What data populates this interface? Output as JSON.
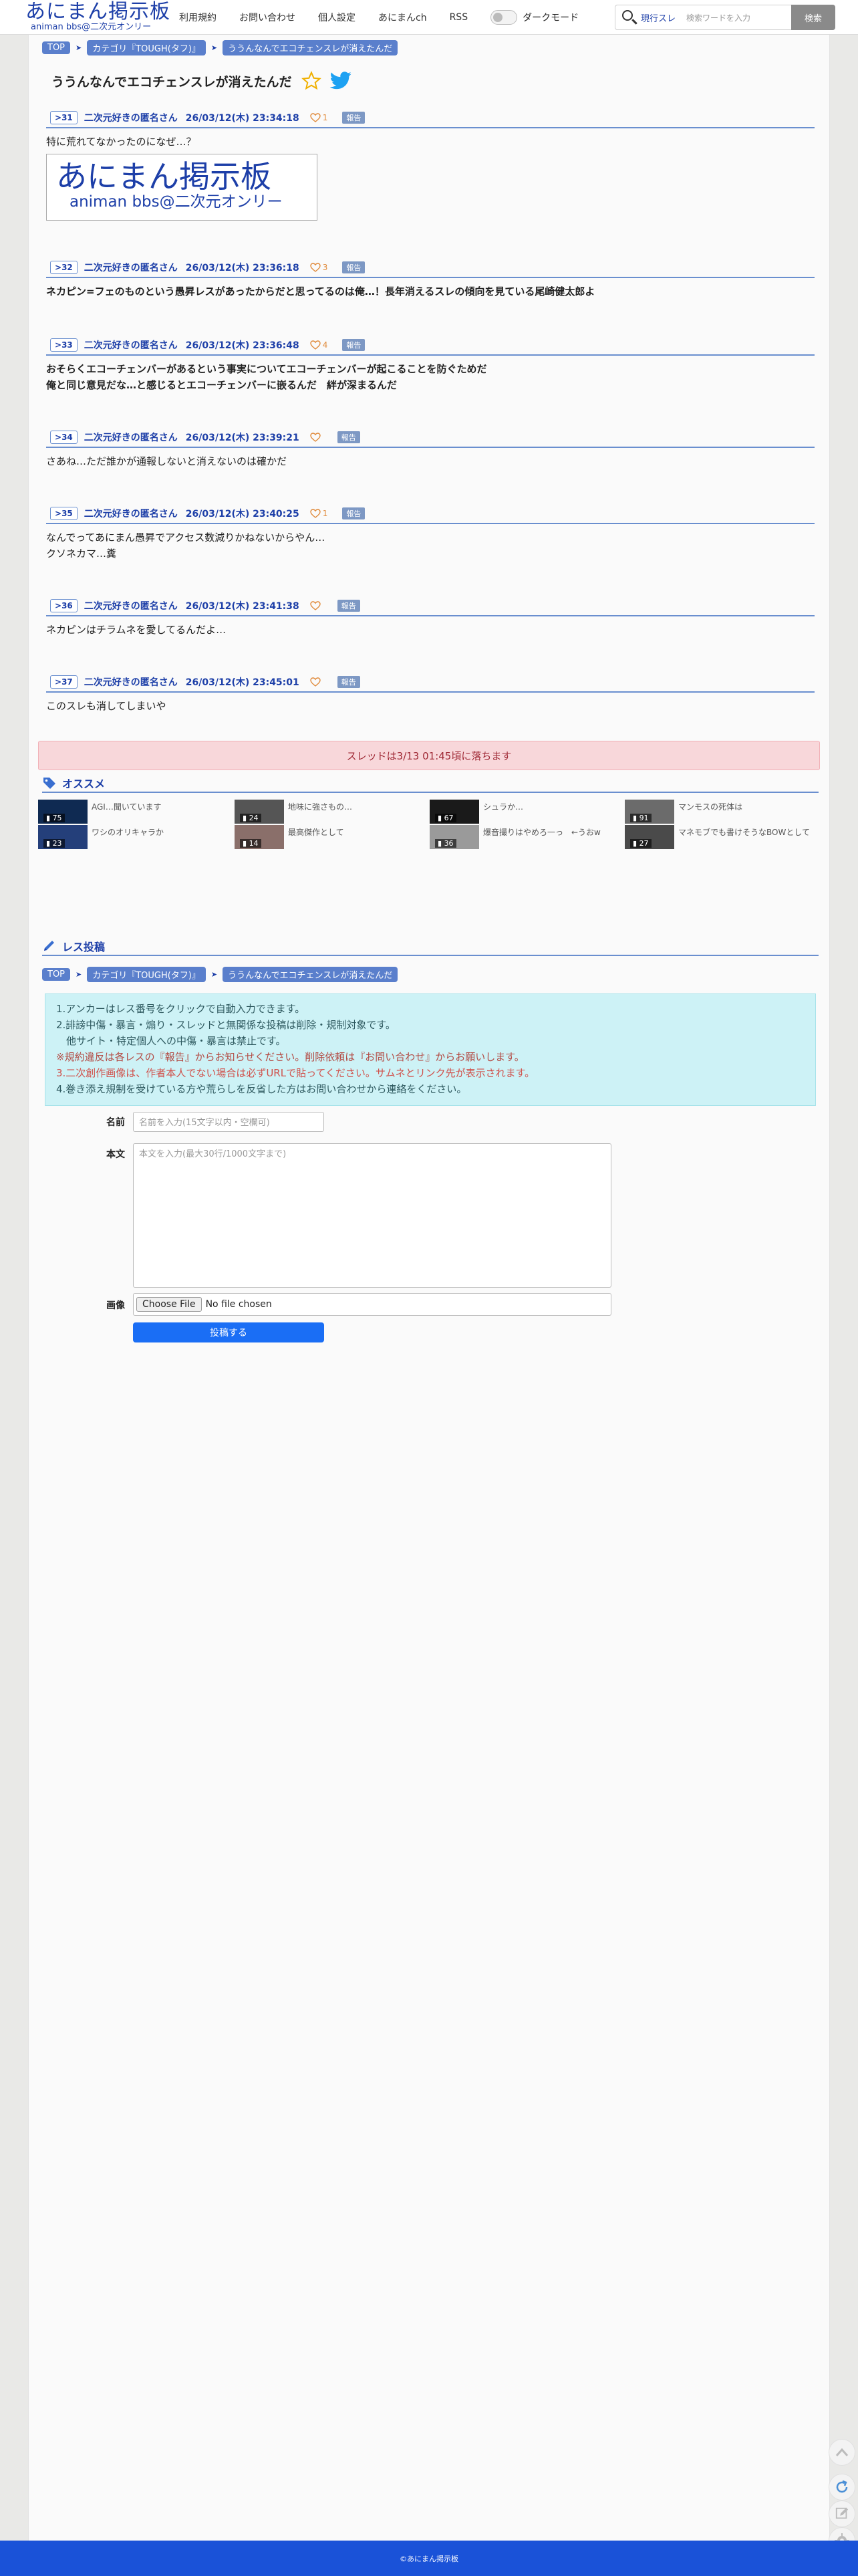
{
  "header": {
    "logo_main": "あにまん掲示板",
    "logo_sub": "animan bbs@二次元オンリー",
    "nav": [
      "利用規約",
      "お問い合わせ",
      "個人設定",
      "あにまんch",
      "RSS"
    ],
    "dark_mode_label": "ダークモード",
    "search_scope": "現行スレ",
    "search_placeholder": "検索ワードを入力",
    "search_button": "検索"
  },
  "breadcrumb": {
    "top": "TOP",
    "category": "カテゴリ『TOUGH(タフ)』",
    "thread": "ううんなんでエコチェンスレが消えたんだ"
  },
  "thread_title": "ううんなんでエコチェンスレが消えたんだ",
  "posts": [
    {
      "num": "31",
      "name": "二次元好きの匿名さん",
      "date": "26/03/12(木) 23:34:18",
      "likes": "1",
      "report": "報告",
      "body": [
        "特に荒れてなかったのになぜ…？"
      ],
      "bold": false,
      "image": {
        "main": "あにまん掲示板",
        "sub": "animan bbs@二次元オンリー"
      }
    },
    {
      "num": "32",
      "name": "二次元好きの匿名さん",
      "date": "26/03/12(木) 23:36:18",
      "likes": "3",
      "report": "報告",
      "body": [
        "ネカピン=フェのものという愚昇レスがあったからだと思ってるのは俺…！長年消えるスレの傾向を見ている尾崎健太郎よ"
      ],
      "bold": true
    },
    {
      "num": "33",
      "name": "二次元好きの匿名さん",
      "date": "26/03/12(木) 23:36:48",
      "likes": "4",
      "report": "報告",
      "body": [
        "おそらくエコーチェンバーがあるという事実についてエコーチェンバーが起こることを防ぐためだ",
        "俺と同じ意見だな…と感じるとエコーチェンバーに嵌るんだ　絆が深まるんだ"
      ],
      "bold": true
    },
    {
      "num": "34",
      "name": "二次元好きの匿名さん",
      "date": "26/03/12(木) 23:39:21",
      "likes": "",
      "report": "報告",
      "body": [
        "さあね…ただ誰かが通報しないと消えないのは確かだ"
      ],
      "bold": false
    },
    {
      "num": "35",
      "name": "二次元好きの匿名さん",
      "date": "26/03/12(木) 23:40:25",
      "likes": "1",
      "report": "報告",
      "body": [
        "なんでってあにまん愚昇でアクセス数減りかねないからやん…",
        "クソネカマ…糞"
      ],
      "bold": false
    },
    {
      "num": "36",
      "name": "二次元好きの匿名さん",
      "date": "26/03/12(木) 23:41:38",
      "likes": "",
      "report": "報告",
      "body": [
        "ネカピンはチラムネを愛してるんだよ…"
      ],
      "bold": false
    },
    {
      "num": "37",
      "name": "二次元好きの匿名さん",
      "date": "26/03/12(木) 23:45:01",
      "likes": "",
      "report": "報告",
      "body": [
        "このスレも消してしまいや"
      ],
      "bold": false
    }
  ],
  "drop_notice": "スレッドは3/13 01:45頃に落ちます",
  "recommend": {
    "title": "オススメ",
    "items": [
      {
        "count": "75",
        "text": "AGI…聞いています"
      },
      {
        "count": "24",
        "text": "地味に強さもの…"
      },
      {
        "count": "67",
        "text": "シュラか…"
      },
      {
        "count": "91",
        "text": "マンモスの死体は"
      },
      {
        "count": "23",
        "text": "ワシのオリキャラか"
      },
      {
        "count": "14",
        "text": "最高傑作として"
      },
      {
        "count": "36",
        "text": "爆音撮りはやめろ一っ　←うおw"
      },
      {
        "count": "27",
        "text": "マネモブでも書けそうなBOWとして"
      }
    ]
  },
  "reply": {
    "title": "レス投稿",
    "notes": [
      "1.アンカーはレス番号をクリックで自動入力できます。",
      "2.誹謗中傷・暴言・煽り・スレッドと無関係な投稿は削除・規制対象です。",
      "　他サイト・特定個人への中傷・暴言は禁止です。",
      "※規約違反は各レスの『報告』からお知らせください。削除依頼は『お問い合わせ』からお願いします。",
      "3.二次創作画像は、作者本人でない場合は必ずURLで貼ってください。サムネとリンク先が表示されます。",
      "4.巻き添え規制を受けている方や荒らしを反省した方はお問い合わせから連絡をください。"
    ],
    "name_label": "名前",
    "name_placeholder": "名前を入力(15文字以内・空欄可)",
    "body_label": "本文",
    "body_placeholder": "本文を入力(最大30行/1000文字まで)",
    "image_label": "画像",
    "file_button": "Choose File",
    "file_status": "No file chosen",
    "submit": "投稿する"
  },
  "footer": "©あにまん掲示板",
  "colors": {
    "accent": "#1d3fa8",
    "crumb": "#5a7fcc",
    "notice_bg": "#f8d7da",
    "notes_bg": "#cdf2f6",
    "submit": "#1a6ef5",
    "footer": "#1a52d8"
  }
}
